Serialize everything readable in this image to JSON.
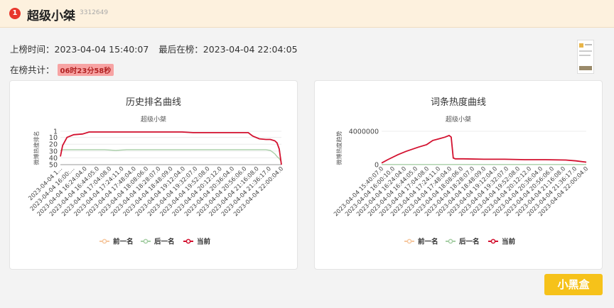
{
  "header": {
    "rank": "1",
    "title": "超级小桀",
    "id": "3312649"
  },
  "info": {
    "first_label": "上榜时间：",
    "first_value": "2023-04-04 15:40:07",
    "last_label": "最后在榜：",
    "last_value": "2023-04-04 22:04:05",
    "total_label": "在榜共计：",
    "total_value": "06时23分58秒"
  },
  "watermark": "小黑盒",
  "chart_data": [
    {
      "type": "line",
      "title": "历史排名曲线",
      "subtitle": "超级小桀",
      "ylabel": "微博热搜排名",
      "y_inverted": true,
      "ylim": [
        1,
        50
      ],
      "yticks": [
        "1",
        "10",
        "20",
        "30",
        "40",
        "50"
      ],
      "x_labels": [
        "2023-04-04 1...",
        "2023-04-04 16:00:...",
        "2023-04-04 16:24:04.0",
        "2023-04-04 16:44:05.0",
        "2023-04-04 17:04:08.0",
        "2023-04-04 17:24:11.0",
        "2023-04-04 17:48:04.0",
        "2023-04-04 18:08:06.0",
        "2023-04-04 18:28:07.0",
        "2023-04-04 18:48:09.0",
        "2023-04-04 19:12:04.0",
        "2023-04-04 19:32:07.0",
        "2023-04-04 19:52:08.0",
        "2023-04-04 20:12:12.0",
        "2023-04-04 20:36:04.0",
        "2023-04-04 20:56:06.0",
        "2023-04-04 21:16:08.0",
        "2023-04-04 21:36:17.0",
        "2023-04-04 22:00:04.0"
      ],
      "x": [
        0,
        0.01,
        0.03,
        0.06,
        0.1,
        0.13,
        0.17,
        0.2,
        0.25,
        0.3,
        0.35,
        0.4,
        0.45,
        0.5,
        0.55,
        0.6,
        0.65,
        0.7,
        0.75,
        0.8,
        0.85,
        0.87,
        0.9,
        0.93,
        0.95,
        0.97,
        0.98,
        0.99,
        1
      ],
      "series": [
        {
          "name": "前一名",
          "color": "#f6c8a0",
          "values": []
        },
        {
          "name": "后一名",
          "color": "#a7cfa6",
          "values": [
            29,
            28,
            28,
            28,
            28,
            28,
            28,
            28,
            29,
            28,
            28,
            28,
            28,
            28,
            28,
            28,
            28,
            28,
            28,
            28,
            28,
            28,
            28,
            28,
            29,
            34,
            38,
            41,
            46
          ]
        },
        {
          "name": "当前",
          "color": "#d3112f",
          "values": [
            38,
            22,
            10,
            6,
            5,
            2,
            2,
            2,
            2,
            2,
            2,
            2,
            2,
            2,
            2,
            3,
            3,
            3,
            3,
            3,
            3,
            8,
            12,
            13,
            13,
            15,
            18,
            27,
            50
          ]
        }
      ],
      "legend": "bottom"
    },
    {
      "type": "line",
      "title": "词条热度曲线",
      "subtitle": "超级小桀",
      "ylabel": "微博热度趋势",
      "ylim": [
        0,
        4000000
      ],
      "yticks": [
        "0",
        "4000000"
      ],
      "x_labels": [
        "2023-04-04 15:40:07.0",
        "2023-04-04 16:00:10.0",
        "2023-04-04 16:24:04.0",
        "2023-04-04 16:44:05.0",
        "2023-04-04 17:04:08.0",
        "2023-04-04 17:24:11.0",
        "2023-04-04 17:48:04.0",
        "2023-04-04 18:08:06.0",
        "2023-04-04 18:28:07.0",
        "2023-04-04 18:48:09.0",
        "2023-04-04 19:12:04.0",
        "2023-04-04 19:32:07.0",
        "2023-04-04 19:52:08.0",
        "2023-04-04 20:12:12.0",
        "2023-04-04 20:36:04.0",
        "2023-04-04 20:56:06.0",
        "2023-04-04 21:16:08.0",
        "2023-04-04 21:36:17.0",
        "2023-04-04 22:00:04.0"
      ],
      "x": [
        0,
        0.03,
        0.08,
        0.12,
        0.18,
        0.22,
        0.25,
        0.28,
        0.31,
        0.33,
        0.34,
        0.35,
        0.36,
        0.4,
        0.5,
        0.6,
        0.7,
        0.8,
        0.9,
        0.95,
        1
      ],
      "series": [
        {
          "name": "前一名",
          "color": "#f6c8a0",
          "values": []
        },
        {
          "name": "后一名",
          "color": "#a7cfa6",
          "values": [
            20000,
            20000,
            20000,
            20000,
            20000,
            20000,
            20000,
            20000,
            20000,
            20000,
            20000,
            20000,
            20000,
            20000,
            20000,
            20000,
            20000,
            20000,
            20000,
            20000,
            20000
          ]
        },
        {
          "name": "当前",
          "color": "#d3112f",
          "values": [
            200000,
            600000,
            1200000,
            1600000,
            2100000,
            2400000,
            2900000,
            3100000,
            3300000,
            3500000,
            3300000,
            800000,
            700000,
            700000,
            650000,
            650000,
            600000,
            600000,
            550000,
            450000,
            300000
          ]
        }
      ],
      "legend": "bottom"
    }
  ]
}
